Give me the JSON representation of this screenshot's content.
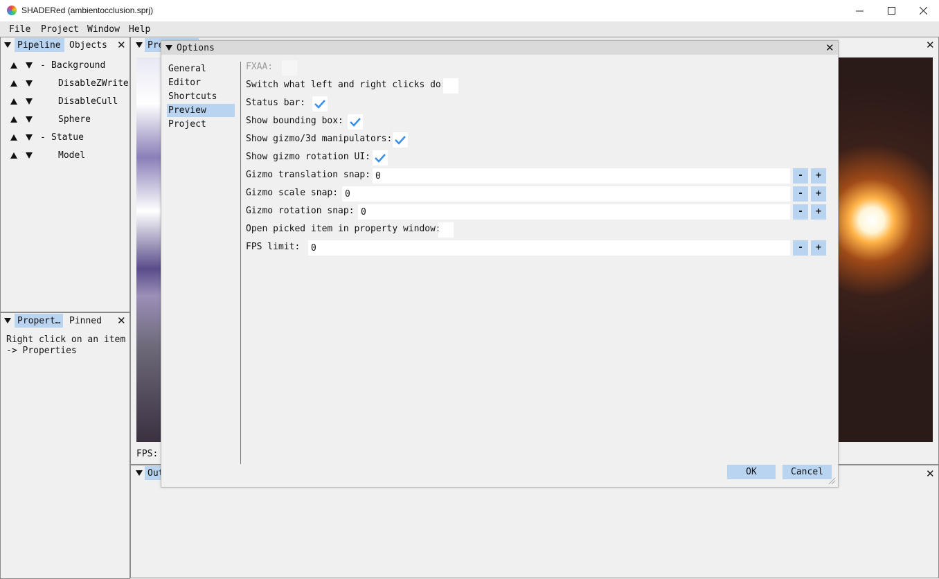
{
  "window": {
    "title": "SHADERed (ambientocclusion.sprj)"
  },
  "menu": [
    "File",
    "Project",
    "Window",
    "Help"
  ],
  "pipeline_panel": {
    "tabs": [
      "Pipeline",
      "Objects"
    ],
    "items": [
      {
        "prefix": "-",
        "label": "Background"
      },
      {
        "prefix": "",
        "label": "DisableZWrite"
      },
      {
        "prefix": "",
        "label": "DisableCull"
      },
      {
        "prefix": "",
        "label": "Sphere"
      },
      {
        "prefix": "-",
        "label": "Statue"
      },
      {
        "prefix": "",
        "label": "Model"
      }
    ]
  },
  "properties_panel": {
    "tabs": [
      "Propert…",
      "Pinned"
    ],
    "hint_line1": "Right click on an item",
    "hint_line2": "-> Properties"
  },
  "preview_panel": {
    "tab": "Pre",
    "fps_label": "FPS:"
  },
  "output_panel": {
    "tab": "Out"
  },
  "options": {
    "title": "Options",
    "nav": [
      "General",
      "Editor",
      "Shortcuts",
      "Preview",
      "Project"
    ],
    "selected_nav": "Preview",
    "settings": {
      "fxaa": {
        "label": "FXAA:",
        "checked": false,
        "disabled": true
      },
      "switch_clicks": {
        "label": "Switch what left and right clicks do:",
        "checked": false
      },
      "status_bar": {
        "label": "Status bar:",
        "checked": true
      },
      "bounding_box": {
        "label": "Show bounding box:",
        "checked": true
      },
      "gizmo_manip": {
        "label": "Show gizmo/3d manipulators:",
        "checked": true
      },
      "gizmo_rot_ui": {
        "label": "Show gizmo rotation UI:",
        "checked": true
      },
      "trans_snap": {
        "label": "Gizmo translation snap:",
        "value": "0"
      },
      "scale_snap": {
        "label": "Gizmo scale snap:",
        "value": "0"
      },
      "rot_snap": {
        "label": "Gizmo rotation snap:",
        "value": "0"
      },
      "open_picked": {
        "label": "Open picked item in property window:",
        "checked": false
      },
      "fps_limit": {
        "label": "FPS limit:",
        "value": "0"
      }
    },
    "minus_label": "-",
    "plus_label": "+",
    "ok_label": "OK",
    "cancel_label": "Cancel"
  },
  "colors": {
    "accent": "#b8d4f0",
    "check": "#3a8ee6"
  }
}
